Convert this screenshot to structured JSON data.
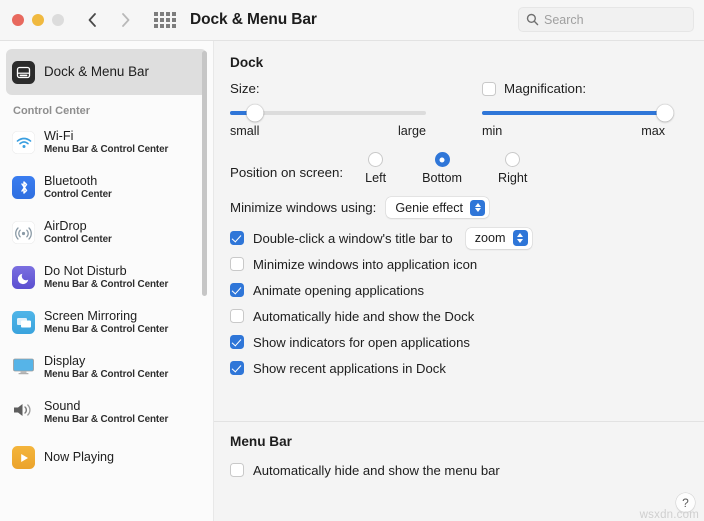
{
  "window": {
    "title": "Dock & Menu Bar",
    "traffic_lights": [
      "close",
      "minimize",
      "zoom"
    ],
    "back_label": "Back",
    "forward_label": "Forward",
    "grid_label": "Show All"
  },
  "search": {
    "placeholder": "Search",
    "value": "",
    "icon": "search-icon"
  },
  "sidebar": {
    "selected": {
      "label": "Dock & Menu Bar",
      "icon": "dock-menu-bar-icon"
    },
    "group_label": "Control Center",
    "items": [
      {
        "label": "Wi-Fi",
        "sublabel": "Menu Bar & Control Center",
        "icon": "wifi-icon"
      },
      {
        "label": "Bluetooth",
        "sublabel": "Control Center",
        "icon": "bluetooth-icon"
      },
      {
        "label": "AirDrop",
        "sublabel": "Control Center",
        "icon": "airdrop-icon"
      },
      {
        "label": "Do Not Disturb",
        "sublabel": "Menu Bar & Control Center",
        "icon": "do-not-disturb-icon"
      },
      {
        "label": "Screen Mirroring",
        "sublabel": "Menu Bar & Control Center",
        "icon": "screen-mirroring-icon"
      },
      {
        "label": "Display",
        "sublabel": "Menu Bar & Control Center",
        "icon": "display-icon"
      },
      {
        "label": "Sound",
        "sublabel": "Menu Bar & Control Center",
        "icon": "sound-icon"
      },
      {
        "label": "Now Playing",
        "sublabel": "",
        "icon": "now-playing-icon"
      }
    ]
  },
  "dock": {
    "section_title": "Dock",
    "size": {
      "label": "Size:",
      "min_label": "small",
      "max_label": "large",
      "value_percent": 13
    },
    "magnification": {
      "label": "Magnification:",
      "checked": false,
      "min_label": "min",
      "max_label": "max",
      "value_percent": 100
    },
    "position": {
      "label": "Position on screen:",
      "options": [
        {
          "label": "Left",
          "selected": false
        },
        {
          "label": "Bottom",
          "selected": true
        },
        {
          "label": "Right",
          "selected": false
        }
      ]
    },
    "minimize_effect": {
      "label": "Minimize windows using:",
      "value": "Genie effect"
    },
    "double_click": {
      "label": "Double-click a window's title bar to",
      "checked": true,
      "value": "zoom"
    },
    "checkboxes": [
      {
        "label": "Minimize windows into application icon",
        "checked": false
      },
      {
        "label": "Animate opening applications",
        "checked": true
      },
      {
        "label": "Automatically hide and show the Dock",
        "checked": false
      },
      {
        "label": "Show indicators for open applications",
        "checked": true
      },
      {
        "label": "Show recent applications in Dock",
        "checked": true
      }
    ]
  },
  "menu_bar": {
    "section_title": "Menu Bar",
    "auto_hide": {
      "label": "Automatically hide and show the menu bar",
      "checked": false
    }
  },
  "help": {
    "label": "?"
  },
  "watermark": {
    "text": "wsxdn.com"
  },
  "colors": {
    "accent": "#2f76d8",
    "sidebar_bg": "#fbfbfb",
    "main_bg": "#f4f4f4",
    "titlebar_bg": "#f6f6f6",
    "selected_row": "#dedede"
  }
}
